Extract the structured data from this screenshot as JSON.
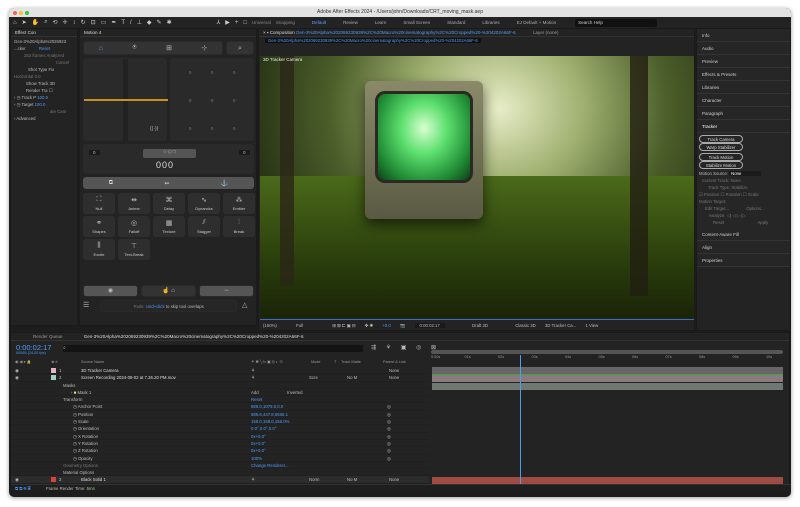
{
  "window": {
    "title": "Adobe After Effects 2024 - /Users/john/Downloads/CRT_moving_mask.aep"
  },
  "toolbar": {
    "universal": "Universal",
    "snapping": "Snapping",
    "workspaces": [
      "Default",
      "Review",
      "Learn",
      "Small Screen",
      "Standard",
      "Libraries",
      "EJ Default + Motion"
    ],
    "search_placeholder": "Search Help"
  },
  "effect_controls": {
    "tab": "Effect Con",
    "layer": "Gen-3%20Alpha%2026923",
    "effect": "...cker",
    "reset": "Reset",
    "frames": "253 frames Analyzed",
    "cancel": "Cancel",
    "shot_type_label": "Shot Type",
    "shot_type": "Fix",
    "horizontal_label": "Horizontal",
    "horizontal": "0.0",
    "show_track_label": "Show Track",
    "show_track": "3D",
    "render_label": "Render Tra",
    "track_p_label": "Track P",
    "track_p": "100.0",
    "target_label": "Target",
    "target": "100.0",
    "create": "ate Cam",
    "advanced": "Advanced"
  },
  "motion": {
    "tab": "Motion 4",
    "left_num": "0",
    "right_num": "0",
    "counter": "000",
    "tools": [
      "Null",
      "Anime",
      "Delay",
      "Dynamics",
      "Emitter",
      "Shapes",
      "Falloff",
      "Texture",
      "Stagger",
      "Break",
      "Excite",
      "Text-Break"
    ],
    "hint_prefix": "Tools:",
    "hint_key": "cmd+click",
    "hint_suffix": "to skip tool overlaps"
  },
  "composition": {
    "tab_label": "Composition",
    "comp_name": "Gen-3%20Alpha%202069230939%2C%20Macro%20cinematography%2C%20Cropped%20-%204202A66F-6",
    "sub_tab": "Gen-3%20Alpha%202069230939%2C%20Macro%20cinematography%2C%20Cropped%20-%204202A66F-6",
    "layer_tab": "Layer (none)",
    "camera_label": "3D Tracker Camera",
    "zoom": "(150%)",
    "resolution": "Full",
    "exposure": "+0.0",
    "timecode": "0:00:02:17",
    "draft": "Draft 3D",
    "renderer": "Classic 3D",
    "camera": "3D Tracker Ca...",
    "view": "1 View"
  },
  "right_panel": {
    "items_top": [
      "Info",
      "Audio",
      "Preview",
      "Effects & Presets",
      "Libraries",
      "Character",
      "Paragraph"
    ],
    "tracker": "Tracker",
    "track_camera": "Track Camera",
    "warp_stabilizer": "Warp Stabilizer",
    "track_motion": "Track Motion",
    "stabilize_motion": "Stabilize Motion",
    "motion_source_label": "Motion Source:",
    "motion_source": "None",
    "current_track_label": "Current Track:",
    "current_track": "None",
    "track_type_label": "Track Type:",
    "track_type": "Stabilize",
    "position": "Position",
    "rotation": "Rotation",
    "scale": "Scale",
    "motion_target": "Motion Target:",
    "edit_target": "Edit Target...",
    "options": "Options...",
    "analyze": "Analyze:",
    "reset": "Reset",
    "apply": "Apply",
    "items_bottom": [
      "Content-Aware Fill",
      "Align",
      "Properties"
    ]
  },
  "timeline": {
    "render_queue": "Render Queue",
    "comp_tab": "Gen-3%20Alpha%202069230939%2C%20Macro%20cinematography%2C%20Cropped%20-%204202A66F-6",
    "timecode": "0:00:02:17",
    "frames": "00065 (24.00 fps)",
    "search_placeholder": "",
    "headers": {
      "source": "Source Name",
      "mode": "Mode",
      "t": "T",
      "track_matte": "Track Matte",
      "parent": "Parent & Link"
    },
    "layers": [
      {
        "num": "1",
        "name": "3D Tracker Camera",
        "color": "#e8b4c4",
        "parent": "None"
      },
      {
        "num": "2",
        "name": "Screen Recording 2024-08-02 at 7.26.20 PM.mov",
        "color": "#9fd0c4",
        "mode": "Scre",
        "matte": "No M",
        "parent": "None"
      },
      {
        "num": "3",
        "name": "Black Solid 1",
        "color": "#d4463a",
        "mode": "Norm",
        "matte": "No M",
        "parent": "None"
      }
    ],
    "masks": "Masks",
    "mask1": "Mask 1",
    "mask_mode": "Add",
    "inverted": "Inverted",
    "transform": "Transform",
    "transform_reset": "Reset",
    "props": [
      {
        "name": "Anchor Point",
        "value": "888.0,1079.0,0.0"
      },
      {
        "name": "Position",
        "value": "585.6,447.8,6565.1"
      },
      {
        "name": "Scale",
        "value": "158.0,158.0,158.0%"
      },
      {
        "name": "Orientation",
        "value": "0.0°,0.0°,0.0°"
      },
      {
        "name": "X Rotation",
        "value": "0x+0.0°"
      },
      {
        "name": "Y Rotation",
        "value": "0x+0.0°"
      },
      {
        "name": "Z Rotation",
        "value": "0x+0.0°"
      },
      {
        "name": "Opacity",
        "value": "100%"
      }
    ],
    "geometry": "Geometry Options",
    "change_renderer": "Change Renderer...",
    "material": "Material Options",
    "ruler": [
      "0:00s",
      "01s",
      "02s",
      "03s",
      "04s",
      "05s",
      "06s",
      "07s",
      "08s",
      "09s",
      "10s"
    ],
    "playhead_fraction": 0.265,
    "frame_render_label": "Frame Render Time:",
    "frame_render": "5ms"
  }
}
